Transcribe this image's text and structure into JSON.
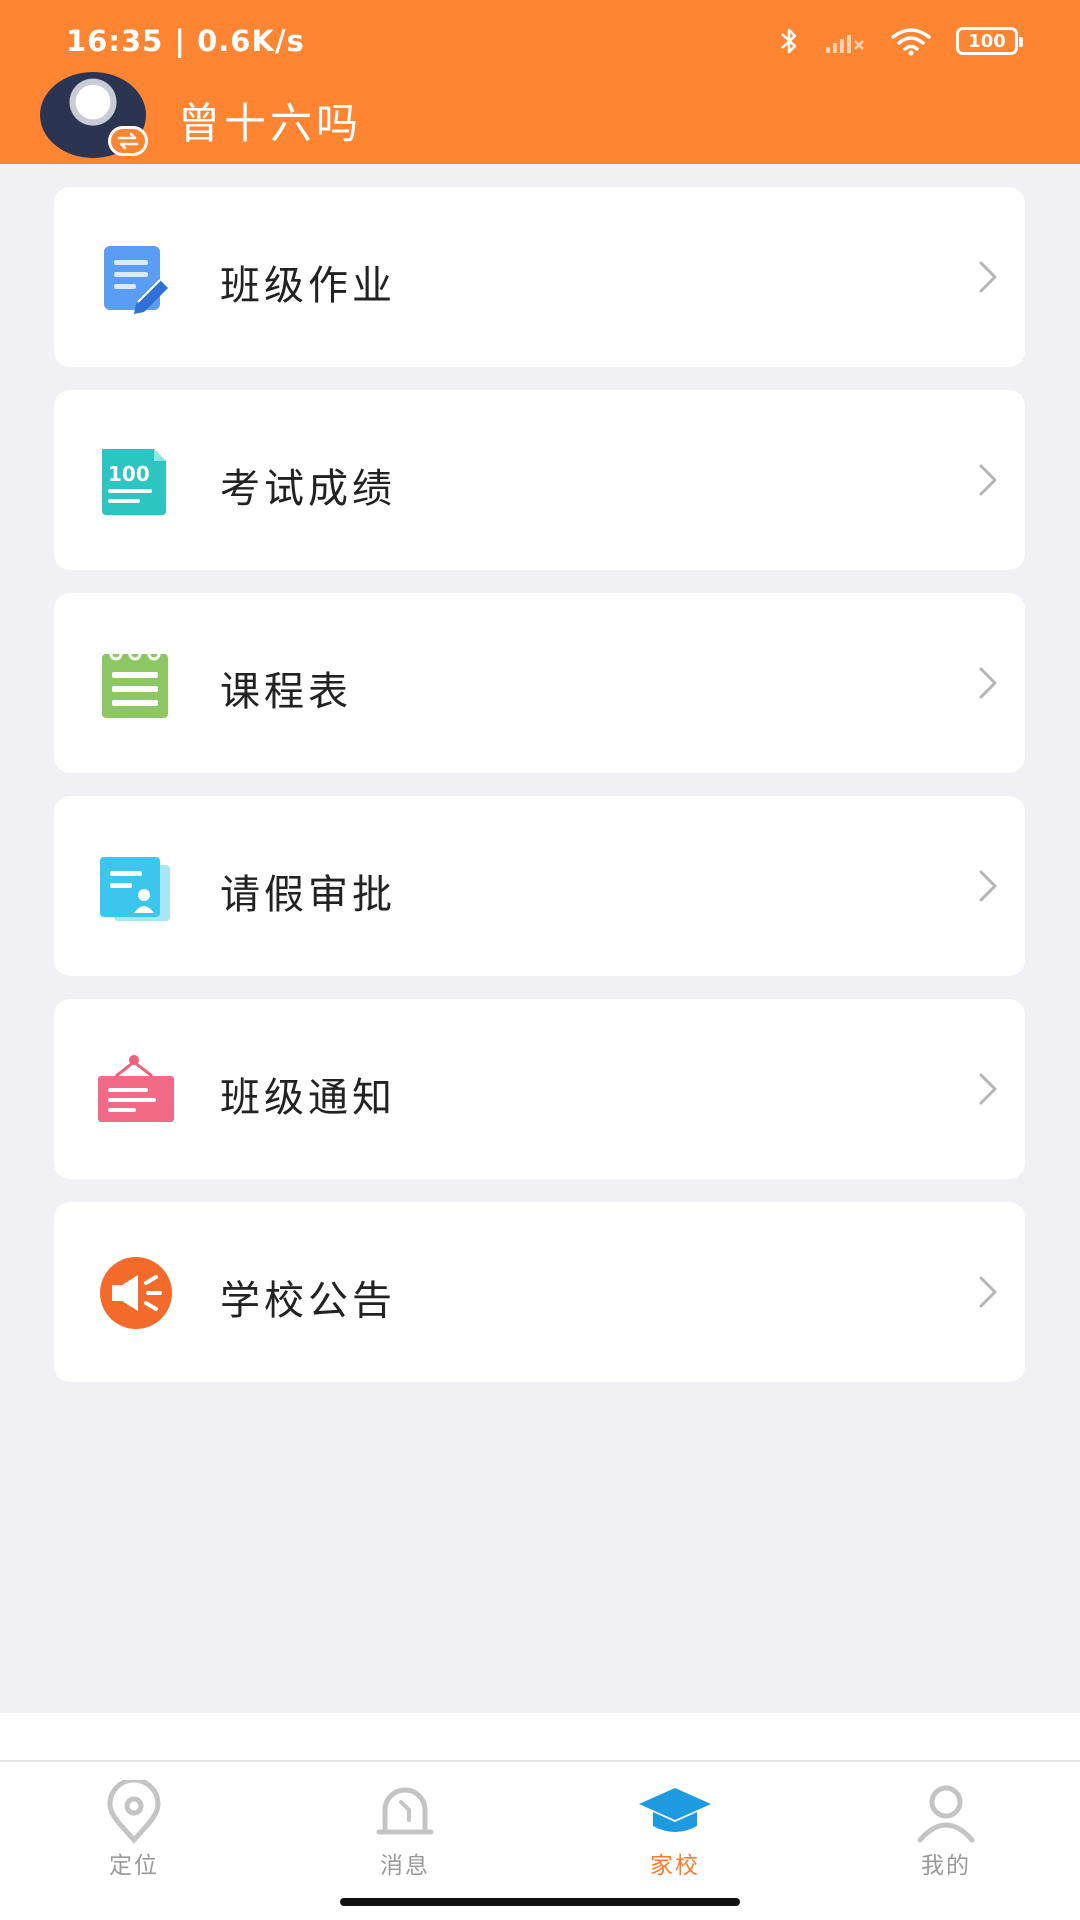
{
  "status_bar": {
    "time": "16:35 | 0.6K/s",
    "battery": "100"
  },
  "header": {
    "user_name": "曾十六吗"
  },
  "menu": [
    {
      "label": "班级作业",
      "icon": "homework-icon"
    },
    {
      "label": "考试成绩",
      "icon": "exam-score-icon"
    },
    {
      "label": "课程表",
      "icon": "schedule-icon"
    },
    {
      "label": "请假审批",
      "icon": "leave-approval-icon"
    },
    {
      "label": "班级通知",
      "icon": "class-notice-icon"
    },
    {
      "label": "学校公告",
      "icon": "school-announcement-icon"
    }
  ],
  "bottom_nav": {
    "active": "家校",
    "items": [
      {
        "label": "定位",
        "icon": "location-pin-icon"
      },
      {
        "label": "消息",
        "icon": "bell-icon"
      },
      {
        "label": "家校",
        "icon": "graduation-cap-icon"
      },
      {
        "label": "我的",
        "icon": "user-icon"
      }
    ]
  },
  "colors": {
    "header": "#ff8533",
    "active_tab": "#ff7a2a",
    "inactive_tab": "#9a9a9a",
    "background": "#f1f1f5"
  }
}
